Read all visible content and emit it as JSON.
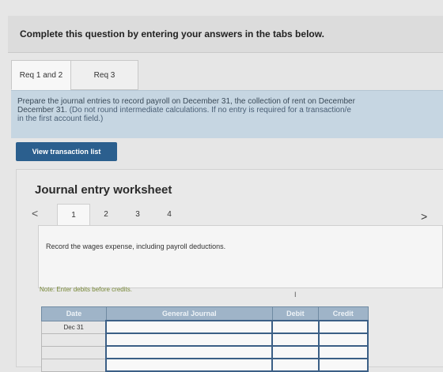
{
  "header": {
    "instruction": "Complete this question by entering your answers in the tabs below."
  },
  "tabs": [
    {
      "label": "Req 1 and 2",
      "active": true
    },
    {
      "label": "Req 3",
      "active": false
    }
  ],
  "info": {
    "line1": "Prepare the journal entries to record payroll on December 31, the collection of rent on December",
    "line2a": "December 31. ",
    "line2b": "(Do not round intermediate calculations. If no entry is required for a transaction/e",
    "line3": "in the first account field.)"
  },
  "view_button": {
    "label": "View transaction list"
  },
  "worksheet": {
    "title": "Journal entry worksheet",
    "nav_prev": "<",
    "nav_next": ">",
    "pages": [
      "1",
      "2",
      "3",
      "4"
    ],
    "active_page": "1",
    "instruction": "Record the wages expense, including payroll deductions.",
    "note": "Note: Enter debits before credits.",
    "cursor_mark": "I"
  },
  "journal": {
    "columns": {
      "date": "Date",
      "general_journal": "General Journal",
      "debit": "Debit",
      "credit": "Credit"
    },
    "rows": [
      {
        "date": "Dec 31"
      },
      {
        "date": ""
      },
      {
        "date": ""
      },
      {
        "date": ""
      }
    ]
  },
  "colors": {
    "accent": "#2b5f8e",
    "info_bg": "#c6d6e2",
    "table_header": "#9fb4c8"
  }
}
